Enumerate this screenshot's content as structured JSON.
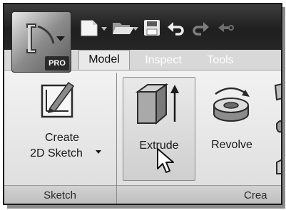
{
  "app_menu": {
    "edition_badge": "PRO",
    "logo_icon": "inventor-logo-icon"
  },
  "quick_access": [
    {
      "icon": "new-document-icon"
    },
    {
      "icon": "open-folder-icon"
    },
    {
      "icon": "save-icon"
    },
    {
      "icon": "undo-icon"
    },
    {
      "icon": "redo-icon"
    },
    {
      "icon": "return-icon"
    }
  ],
  "tabs": [
    {
      "label": "Model",
      "active": true
    },
    {
      "label": "Inspect",
      "active": false
    },
    {
      "label": "Tools",
      "active": false
    }
  ],
  "panels": {
    "sketch": {
      "label": "Sketch",
      "create_2d_sketch": {
        "line1": "Create",
        "line2": "2D Sketch",
        "has_dropdown": true
      }
    },
    "create": {
      "label": "Crea",
      "extrude": {
        "label": "Extrude",
        "hovered": true
      },
      "revolve": {
        "label": "Revolve"
      }
    }
  },
  "colors": {
    "titlebar": "#262626",
    "ribbon": "#e6e6e6",
    "highlight": "#d6d6d6"
  }
}
